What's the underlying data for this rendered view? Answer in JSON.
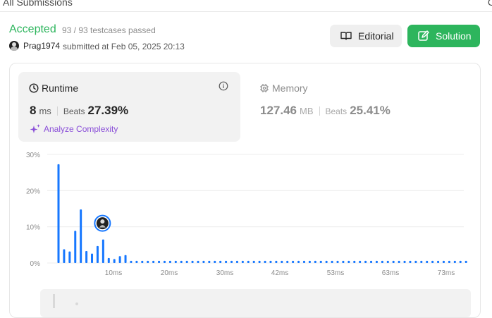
{
  "header": {
    "title": "All Submissions",
    "corner": "C"
  },
  "status": {
    "label": "Accepted",
    "testcases": "93 / 93 testcases passed"
  },
  "submission": {
    "username": "Prag1974",
    "submitted": "submitted at Feb 05, 2025 20:13"
  },
  "buttons": {
    "editorial": "Editorial",
    "solution": "Solution"
  },
  "runtime": {
    "label": "Runtime",
    "value": "8",
    "unit": "ms",
    "beats_label": "Beats",
    "beats_value": "27.39%"
  },
  "memory": {
    "label": "Memory",
    "value": "127.46",
    "unit": "MB",
    "beats_label": "Beats",
    "beats_value": "25.41%"
  },
  "analyze": {
    "label": "Analyze Complexity"
  },
  "colors": {
    "accepted": "#2db55d",
    "bar": "#1677ff",
    "analyze": "#8a4fd8"
  },
  "chart_data": {
    "type": "bar",
    "y_ticks": [
      "30%",
      "20%",
      "10%",
      "0%"
    ],
    "ylim": [
      0,
      30
    ],
    "x_ticks": [
      "10ms",
      "20ms",
      "30ms",
      "42ms",
      "53ms",
      "63ms",
      "73ms"
    ],
    "values": [
      27.3,
      3.8,
      3.2,
      8.9,
      14.8,
      3.3,
      2.6,
      4.7,
      6.5,
      1.4,
      1.1,
      1.9,
      2.2,
      0.6,
      0.6,
      0.6,
      0.6,
      0.6,
      0.6,
      0.6,
      0.6,
      0.6,
      0.6,
      0.6,
      0.6,
      0.6,
      0.6,
      0.6,
      0.6,
      0.6,
      0.6,
      0.6,
      0.6,
      0.6,
      0.6,
      0.6,
      0.6,
      0.6,
      0.6,
      0.6,
      0.6,
      0.6,
      0.6,
      0.6,
      0.6,
      0.6,
      0.6,
      0.6,
      0.6,
      0.6,
      0.6,
      0.6,
      0.6,
      0.6,
      0.6,
      0.6,
      0.6,
      0.6,
      0.6,
      0.6,
      0.6,
      0.6,
      0.6,
      0.6,
      0.6,
      0.6,
      0.6,
      0.6,
      0.6,
      0.6,
      0.6,
      0.6,
      0.6,
      0.6
    ],
    "marker_index": 8
  }
}
